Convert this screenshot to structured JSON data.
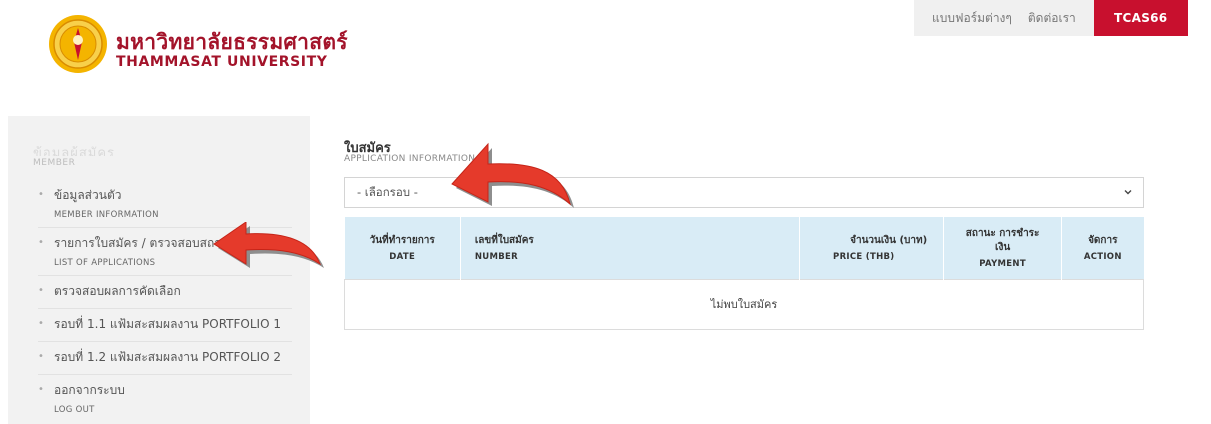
{
  "header": {
    "brand_th": "มหาวิทยาลัยธรรมศาสตร์",
    "brand_en": "THAMMASAT UNIVERSITY",
    "nav": {
      "forms": "แบบฟอร์มต่างๆ",
      "contact": "ติดต่อเรา",
      "cta": "TCAS66"
    }
  },
  "sidebar": {
    "heading_th": "ข้อมูลผู้สมัคร",
    "heading_en": "MEMBER",
    "items": [
      {
        "label_th": "ข้อมูลส่วนตัว",
        "label_en": "MEMBER INFORMATION"
      },
      {
        "label_th": "รายการใบสมัคร / ตรวจสอบสถานะ",
        "label_en": "LIST OF APPLICATIONS"
      },
      {
        "label_th": "ตรวจสอบผลการคัดเลือก",
        "label_en": ""
      },
      {
        "label_th": "รอบที่ 1.1 แฟ้มสะสมผลงาน PORTFOLIO 1",
        "label_en": ""
      },
      {
        "label_th": "รอบที่ 1.2 แฟ้มสะสมผลงาน PORTFOLIO 2",
        "label_en": ""
      },
      {
        "label_th": "ออกจากระบบ",
        "label_en": "LOG OUT"
      }
    ]
  },
  "main": {
    "title_th": "ใบสมัคร",
    "title_en": "APPLICATION INFORMATION",
    "round_select": {
      "selected": "- เลือกรอบ -"
    },
    "table": {
      "columns": [
        {
          "th": "วันที่ทำรายการ",
          "en": "DATE"
        },
        {
          "th": "เลขที่ใบสมัคร",
          "en": "NUMBER"
        },
        {
          "th": "จำนวนเงิน (บาท)",
          "en": "PRICE (THB)"
        },
        {
          "th": "สถานะ การชำระเงิน",
          "en": "PAYMENT"
        },
        {
          "th": "จัดการ",
          "en": "ACTION"
        }
      ],
      "empty_message": "ไม่พบใบสมัคร"
    }
  },
  "colors": {
    "brand": "#a3132a",
    "cta": "#c8102e",
    "table_header": "#d9ecf6",
    "arrow": "#e53a2b"
  }
}
